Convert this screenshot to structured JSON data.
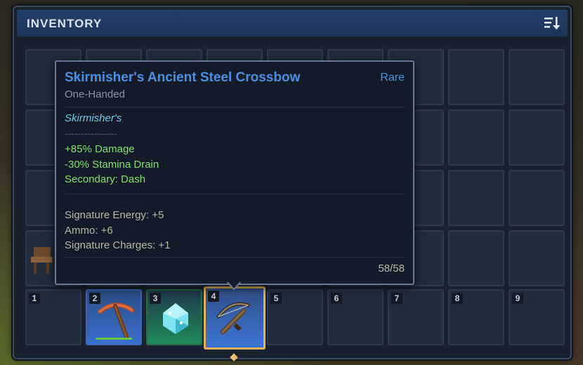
{
  "inventory": {
    "title": "INVENTORY",
    "sort_icon": "sort-icon"
  },
  "tooltip": {
    "name": "Skirmisher's Ancient Steel Crossbow",
    "rarity": "Rare",
    "type": "One-Handed",
    "prefix": "Skirmisher's",
    "separator": "----------------",
    "bonuses": [
      "+85% Damage",
      "-30% Stamina Drain",
      "Secondary: Dash"
    ],
    "stats": [
      "Signature Energy: +5",
      "Ammo: +6",
      "Signature Charges: +1"
    ],
    "charges": "58/58",
    "colors": {
      "rarity": "#4a8fe0",
      "bonus": "#7fe06a",
      "prefix": "#6fc8e6"
    }
  },
  "hotbar": [
    {
      "num": "1",
      "item": ""
    },
    {
      "num": "2",
      "item": "pickaxe-icon"
    },
    {
      "num": "3",
      "item": "crystal-icon"
    },
    {
      "num": "4",
      "item": "crossbow-icon",
      "selected": true
    },
    {
      "num": "5",
      "item": ""
    },
    {
      "num": "6",
      "item": ""
    },
    {
      "num": "7",
      "item": ""
    },
    {
      "num": "8",
      "item": ""
    },
    {
      "num": "9",
      "item": ""
    }
  ]
}
